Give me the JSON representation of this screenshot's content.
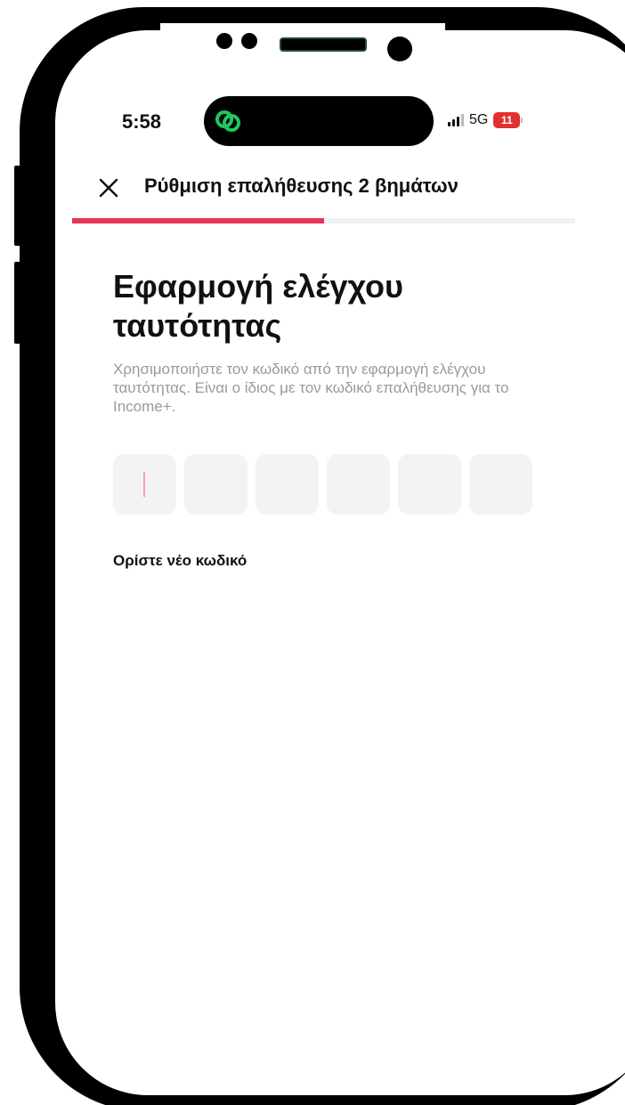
{
  "status_bar": {
    "time": "5:58",
    "network": "5G",
    "battery_level": "11",
    "battery_color": "#e23030",
    "island_app_icon": "chain-link-icon",
    "island_icon_color": "#22c55e"
  },
  "header": {
    "close_icon": "close-icon",
    "title": "Ρύθμιση επαλήθευσης 2 βημάτων"
  },
  "progress": {
    "fraction": 0.5,
    "fill_color": "#e8335a"
  },
  "main": {
    "title": "Εφαρμογή ελέγχου ταυτότητας",
    "description": "Χρησιμοποιήστε τον κωδικό από την εφαρμογή ελέγχου ταυτότητας. Είναι ο ίδιος με τον κωδικό επαλήθευσης για το Income+.",
    "code_digits": [
      "",
      "",
      "",
      "",
      "",
      ""
    ],
    "new_code_link": "Ορίστε νέο κωδικό"
  }
}
